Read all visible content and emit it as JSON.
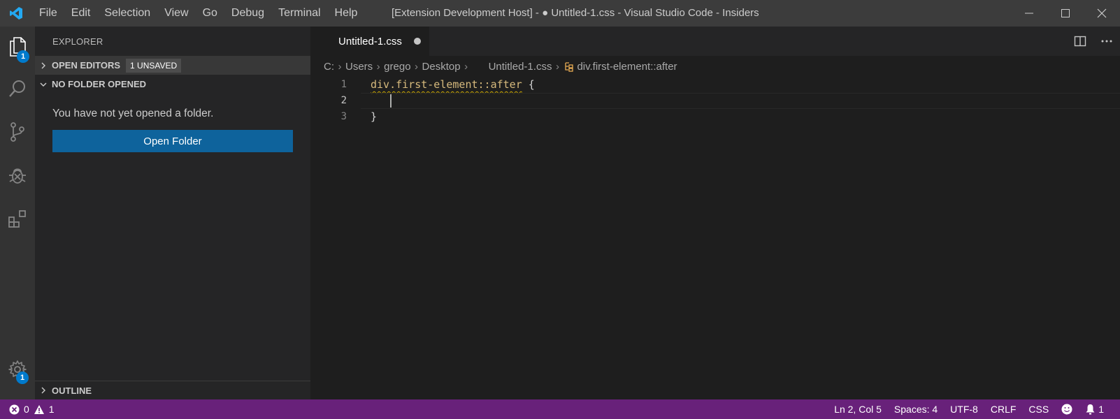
{
  "titlebar": {
    "menu": [
      "File",
      "Edit",
      "Selection",
      "View",
      "Go",
      "Debug",
      "Terminal",
      "Help"
    ],
    "window_title": "[Extension Development Host] - ● Untitled-1.css - Visual Studio Code - Insiders"
  },
  "activitybar": {
    "explorer_badge": "1",
    "settings_badge": "1"
  },
  "sidebar": {
    "title": "EXPLORER",
    "open_editors": {
      "label": "OPEN EDITORS",
      "badge": "1 UNSAVED"
    },
    "no_folder": {
      "label": "NO FOLDER OPENED",
      "message": "You have not yet opened a folder.",
      "button": "Open Folder"
    },
    "outline": {
      "label": "OUTLINE"
    }
  },
  "editor": {
    "tab": {
      "label": "Untitled-1.css"
    },
    "breadcrumbs": [
      "C:",
      "Users",
      "grego",
      "Desktop",
      "Untitled-1.css",
      "div.first-element::after"
    ],
    "lines": [
      {
        "number": "1",
        "text": "div.first-element::after",
        "suffix": " {"
      },
      {
        "number": "2",
        "text": ""
      },
      {
        "number": "3",
        "text": "}"
      }
    ]
  },
  "statusbar": {
    "errors": "0",
    "warnings": "1",
    "position": "Ln 2, Col 5",
    "spaces": "Spaces: 4",
    "encoding": "UTF-8",
    "eol": "CRLF",
    "language": "CSS",
    "notifications": "1"
  },
  "colors": {
    "statusbar": "#68217a",
    "accent": "#007acc",
    "button": "#0e639c",
    "selector": "#d7ba7d"
  }
}
